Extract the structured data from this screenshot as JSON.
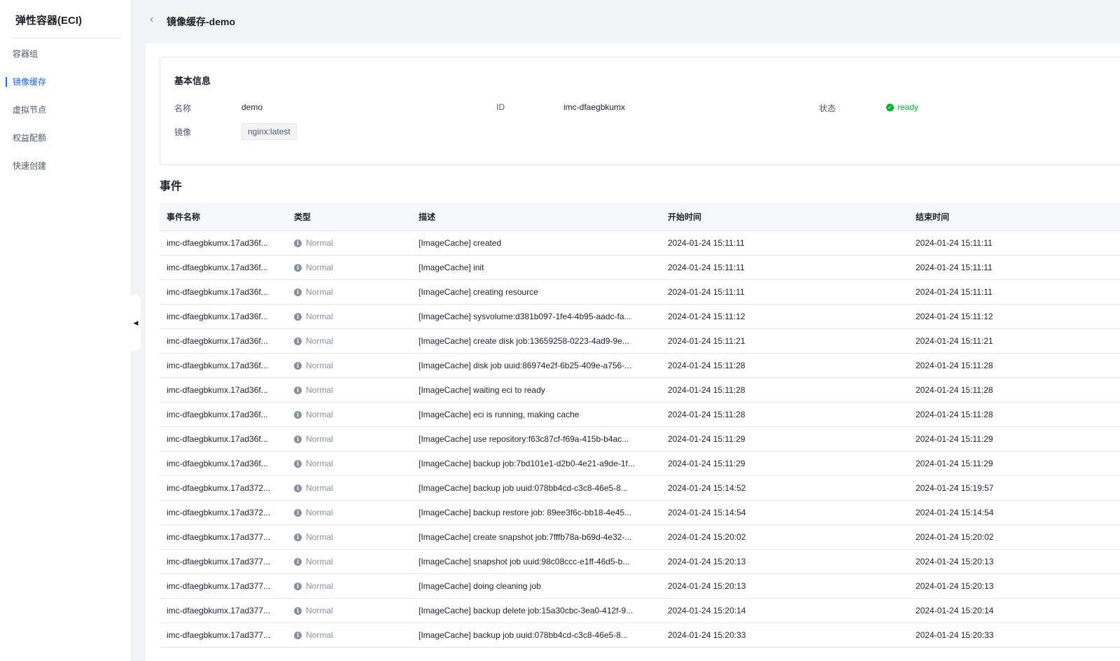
{
  "sidebar": {
    "title": "弹性容器(ECI)",
    "items": [
      {
        "label": "容器组"
      },
      {
        "label": "镜像缓存"
      },
      {
        "label": "虚拟节点"
      },
      {
        "label": "权益配额"
      },
      {
        "label": "快速创建"
      }
    ]
  },
  "header": {
    "back_icon": "chevron-left-icon",
    "title": "镜像缓存-demo"
  },
  "basic_info": {
    "title": "基本信息",
    "name_label": "名称",
    "name_value": "demo",
    "id_label": "ID",
    "id_value": "imc-dfaegbkumx",
    "status_label": "状态",
    "status_value": "ready",
    "image_label": "镜像",
    "image_value": "nginx:latest"
  },
  "events": {
    "title": "事件",
    "columns": [
      "事件名称",
      "类型",
      "描述",
      "开始时间",
      "结束时间"
    ],
    "rows": [
      {
        "name": "imc-dfaegbkumx.17ad36f...",
        "type": "Normal",
        "desc": "[ImageCache] created",
        "start": "2024-01-24 15:11:11",
        "end": "2024-01-24 15:11:11"
      },
      {
        "name": "imc-dfaegbkumx.17ad36f...",
        "type": "Normal",
        "desc": "[ImageCache] init",
        "start": "2024-01-24 15:11:11",
        "end": "2024-01-24 15:11:11"
      },
      {
        "name": "imc-dfaegbkumx.17ad36f...",
        "type": "Normal",
        "desc": "[ImageCache] creating resource",
        "start": "2024-01-24 15:11:11",
        "end": "2024-01-24 15:11:11"
      },
      {
        "name": "imc-dfaegbkumx.17ad36f...",
        "type": "Normal",
        "desc": "[ImageCache] sysvolume:d381b097-1fe4-4b95-aadc-fa...",
        "start": "2024-01-24 15:11:12",
        "end": "2024-01-24 15:11:12"
      },
      {
        "name": "imc-dfaegbkumx.17ad36f...",
        "type": "Normal",
        "desc": "[ImageCache] create disk job:13659258-0223-4ad9-9e...",
        "start": "2024-01-24 15:11:21",
        "end": "2024-01-24 15:11:21"
      },
      {
        "name": "imc-dfaegbkumx.17ad36f...",
        "type": "Normal",
        "desc": "[ImageCache] disk job uuid:86974e2f-6b25-409e-a756-...",
        "start": "2024-01-24 15:11:28",
        "end": "2024-01-24 15:11:28"
      },
      {
        "name": "imc-dfaegbkumx.17ad36f...",
        "type": "Normal",
        "desc": "[ImageCache] waiting eci to ready",
        "start": "2024-01-24 15:11:28",
        "end": "2024-01-24 15:11:28"
      },
      {
        "name": "imc-dfaegbkumx.17ad36f...",
        "type": "Normal",
        "desc": "[ImageCache] eci is running, making cache",
        "start": "2024-01-24 15:11:28",
        "end": "2024-01-24 15:11:28"
      },
      {
        "name": "imc-dfaegbkumx.17ad36f...",
        "type": "Normal",
        "desc": "[ImageCache] use repository:f63c87cf-f69a-415b-b4ac...",
        "start": "2024-01-24 15:11:29",
        "end": "2024-01-24 15:11:29"
      },
      {
        "name": "imc-dfaegbkumx.17ad36f...",
        "type": "Normal",
        "desc": "[ImageCache] backup job:7bd101e1-d2b0-4e21-a9de-1f...",
        "start": "2024-01-24 15:11:29",
        "end": "2024-01-24 15:11:29"
      },
      {
        "name": "imc-dfaegbkumx.17ad372...",
        "type": "Normal",
        "desc": "[ImageCache] backup job uuid:078bb4cd-c3c8-46e5-8...",
        "start": "2024-01-24 15:14:52",
        "end": "2024-01-24 15:19:57"
      },
      {
        "name": "imc-dfaegbkumx.17ad372...",
        "type": "Normal",
        "desc": "[ImageCache] backup restore job: 89ee3f6c-bb18-4e45...",
        "start": "2024-01-24 15:14:54",
        "end": "2024-01-24 15:14:54"
      },
      {
        "name": "imc-dfaegbkumx.17ad377...",
        "type": "Normal",
        "desc": "[ImageCache] create snapshot job:7fffb78a-b69d-4e32-...",
        "start": "2024-01-24 15:20:02",
        "end": "2024-01-24 15:20:02"
      },
      {
        "name": "imc-dfaegbkumx.17ad377...",
        "type": "Normal",
        "desc": "[ImageCache] snapshot job uuid:98c08ccc-e1ff-46d5-b...",
        "start": "2024-01-24 15:20:13",
        "end": "2024-01-24 15:20:13"
      },
      {
        "name": "imc-dfaegbkumx.17ad377...",
        "type": "Normal",
        "desc": "[ImageCache] doing cleaning job",
        "start": "2024-01-24 15:20:13",
        "end": "2024-01-24 15:20:13"
      },
      {
        "name": "imc-dfaegbkumx.17ad377...",
        "type": "Normal",
        "desc": "[ImageCache] backup delete job:15a30cbc-3ea0-412f-9...",
        "start": "2024-01-24 15:20:14",
        "end": "2024-01-24 15:20:14"
      },
      {
        "name": "imc-dfaegbkumx.17ad377...",
        "type": "Normal",
        "desc": "[ImageCache] backup job uuid:078bb4cd-c3c8-46e5-8...",
        "start": "2024-01-24 15:20:33",
        "end": "2024-01-24 15:20:33"
      }
    ]
  },
  "colors": {
    "accent": "#1664ff",
    "success": "#00b42a",
    "muted": "#86909c"
  }
}
